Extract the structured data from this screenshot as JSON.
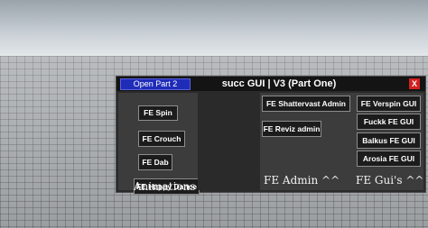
{
  "window": {
    "open_button": "Open Part 2",
    "title": "succ GUI | V3 (Part One)",
    "close_label": "X"
  },
  "animations": {
    "label": "Animations",
    "buttons": [
      "FE Spin",
      "FE Crouch",
      "FE Dab",
      "FE Happy Dance"
    ]
  },
  "admin": {
    "label": "FE Admin ^^",
    "buttons": [
      "FE Shattervast Admin",
      "FE Reviz admin"
    ]
  },
  "guis": {
    "label": "FE Gui's ^^",
    "buttons": [
      "FE Verspin GUI",
      "Fuckk FE GUI",
      "Balkus FE GUI",
      "Arosia FE GUI"
    ]
  },
  "colors": {
    "open_button_bg": "#1f2cb8",
    "close_button_bg": "#d12020",
    "window_bg": "#2a2a2a",
    "panel_bg": "#3c3c3c",
    "button_bg": "#1c1c1c"
  }
}
